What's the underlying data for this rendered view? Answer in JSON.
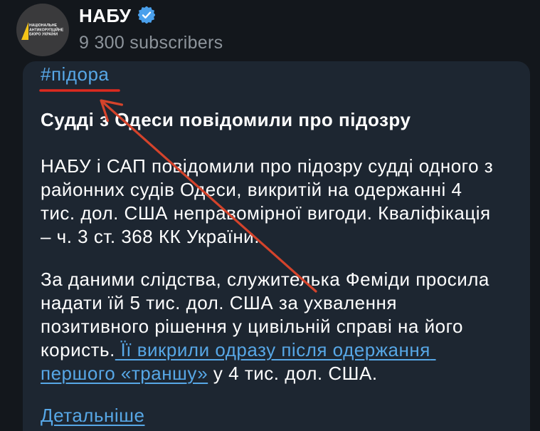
{
  "theme": {
    "background": "#13171c",
    "bubble": "#1d2631",
    "text": "#ffffff",
    "secondary_text": "#8d949b",
    "link": "#57a7e6",
    "verified_badge": "#4aa0ec"
  },
  "channel": {
    "name": "НАБУ",
    "subscribers": "9 300 subscribers",
    "verified_icon": "verified-badge-icon",
    "avatar": {
      "background": "#3a3a3c",
      "logo_color": "#f5c518",
      "logo_lines": [
        "НАЦІОНАЛЬНЕ",
        "АНТИКОРУПЦІЙНЕ",
        "БЮРО УКРАЇНИ"
      ]
    }
  },
  "post": {
    "hashtag": "#підора",
    "title": "Судді з Одеси повідомили про підозру",
    "paragraph1": [
      "НАБУ і САП повідомили про підозру судді одного з",
      "районних судів Одеси, викритій на одержанні 4",
      "тис. дол. США неправомірної вигоди. Кваліфікація",
      "– ч. 3 ст. 368 КК України."
    ],
    "paragraph2": {
      "lines": [
        "За даними слідства, служителька Феміди просила",
        "надати їй 5 тис. дол. США за ухвалення",
        "позитивного рішення у цивільній справі на його"
      ],
      "line4_text": "користь.",
      "link_line1": "Її викрили одразу після одержання",
      "link_line2": "першого «траншу»",
      "line5_text": "у 4 тис. дол. США."
    },
    "more_link": "Детальніше"
  },
  "annotations": {
    "underline_color": "#dd2a1f",
    "arrow_color": "#d4432b",
    "arrow_icon": "arrow-icon"
  }
}
